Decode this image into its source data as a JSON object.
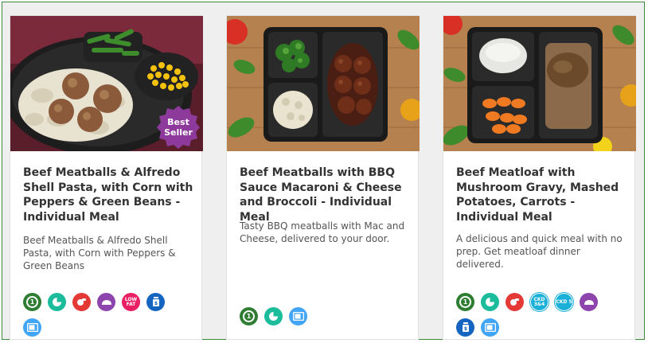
{
  "cards": [
    {
      "title": "Beef Meatballs & Alfredo Shell Pasta, with Corn with Peppers & Green Beans -Individual Meal",
      "description": "Beef Meatballs & Alfredo Shell Pasta, with Corn with Peppers & Green Beans",
      "badge": "Best Seller",
      "icons": [
        {
          "name": "one-serving-icon",
          "label": "1",
          "color": "#2e7d32"
        },
        {
          "name": "no-prep-icon",
          "label": "",
          "color": "#1abc9c"
        },
        {
          "name": "chef-icon",
          "label": "",
          "color": "#e53935"
        },
        {
          "name": "bread-icon",
          "label": "",
          "color": "#8e44ad"
        },
        {
          "name": "low-fat-icon",
          "label": "LOW FAT",
          "color": "#e91e63"
        },
        {
          "name": "pantry-icon",
          "label": "",
          "color": "#1565c0"
        },
        {
          "name": "microwave-icon",
          "label": "",
          "color": "#42a5f5"
        }
      ]
    },
    {
      "title": "Beef Meatballs with BBQ Sauce Macaroni & Cheese and Broccoli - Individual Meal",
      "description": "Tasty BBQ meatballs with Mac and Cheese, delivered to your door.",
      "icons": [
        {
          "name": "one-serving-icon",
          "label": "1",
          "color": "#2e7d32"
        },
        {
          "name": "no-prep-icon",
          "label": "",
          "color": "#1abc9c"
        },
        {
          "name": "microwave-icon",
          "label": "",
          "color": "#42a5f5"
        }
      ]
    },
    {
      "title": "Beef Meatloaf with Mushroom Gravy, Mashed Potatoes, Carrots - Individual Meal",
      "description": "A delicious and quick meal with no prep. Get meatloaf dinner delivered.",
      "icons": [
        {
          "name": "one-serving-icon",
          "label": "1",
          "color": "#2e7d32"
        },
        {
          "name": "no-prep-icon",
          "label": "",
          "color": "#1abc9c"
        },
        {
          "name": "chef-icon",
          "label": "",
          "color": "#e53935"
        },
        {
          "name": "ckd-3-4-icon",
          "label": "CKD 3&4",
          "color": "#1ab0d8"
        },
        {
          "name": "ckd-5-icon",
          "label": "CKD 5",
          "color": "#1ab0d8"
        },
        {
          "name": "bread-icon",
          "label": "",
          "color": "#8e44ad"
        },
        {
          "name": "pantry-icon",
          "label": "",
          "color": "#1565c0"
        },
        {
          "name": "microwave-icon",
          "label": "",
          "color": "#42a5f5"
        }
      ]
    }
  ]
}
